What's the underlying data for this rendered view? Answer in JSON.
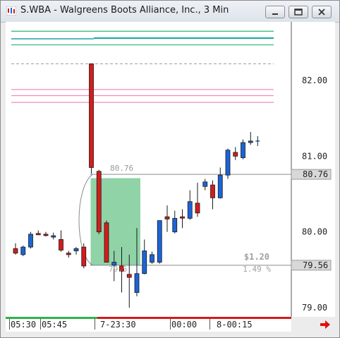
{
  "window": {
    "title": "S.WBA - Walgreens Boots Alliance, Inc., 3 Min",
    "app_icon": "chart-app-icon",
    "controls": [
      "minimize-icon",
      "restore-icon",
      "close-icon"
    ]
  },
  "price_axis": {
    "ticks": [
      "82.00",
      "81.00",
      "80.00",
      "79.00"
    ],
    "tags": {
      "upper": "80.76",
      "lower": "79.56"
    }
  },
  "annotation": {
    "level_label": "80.76",
    "change_amount": "$1.20",
    "change_percent": "1.49 %",
    "partial_label": "79.5"
  },
  "time_axis": {
    "labels": [
      "05:30",
      "05:45",
      "7-23:30",
      "00:00",
      "8-00:15"
    ]
  },
  "colors": {
    "up_candle": "#1a64d8",
    "down_candle": "#d41c1c",
    "highlight_box": "#7ccb98",
    "reference_lines_green": "#2bb673",
    "reference_lines_cyan": "#15a6a6",
    "reference_lines_pink": "#f08cc0",
    "reference_lines_gray": "#9a9a9a",
    "scroll_arrow": "#e01010"
  },
  "chart_data": {
    "type": "candlestick",
    "ylim": [
      78.85,
      83.0
    ],
    "y_ticks": [
      79.0,
      80.0,
      81.0,
      82.0
    ],
    "candles": [
      {
        "o": 79.78,
        "h": 79.85,
        "l": 79.7,
        "c": 79.72,
        "dir": "down"
      },
      {
        "o": 79.7,
        "h": 79.82,
        "l": 79.68,
        "c": 79.8,
        "dir": "up"
      },
      {
        "o": 79.8,
        "h": 80.0,
        "l": 79.78,
        "c": 79.97,
        "dir": "up"
      },
      {
        "o": 79.98,
        "h": 80.02,
        "l": 79.96,
        "c": 79.97,
        "dir": "down"
      },
      {
        "o": 79.97,
        "h": 80.0,
        "l": 79.94,
        "c": 79.96,
        "dir": "down"
      },
      {
        "o": 79.95,
        "h": 79.99,
        "l": 79.9,
        "c": 79.94,
        "dir": "up"
      },
      {
        "o": 79.9,
        "h": 80.02,
        "l": 79.74,
        "c": 79.76,
        "dir": "down"
      },
      {
        "o": 79.72,
        "h": 79.75,
        "l": 79.66,
        "c": 79.7,
        "dir": "down"
      },
      {
        "o": 79.75,
        "h": 79.8,
        "l": 79.7,
        "c": 79.78,
        "dir": "up"
      },
      {
        "o": 79.8,
        "h": 79.85,
        "l": 79.52,
        "c": 79.55,
        "dir": "down"
      },
      {
        "o": 82.22,
        "h": 82.22,
        "l": 80.77,
        "c": 80.85,
        "dir": "down"
      },
      {
        "o": 80.8,
        "h": 80.82,
        "l": 79.97,
        "c": 80.0,
        "dir": "down"
      },
      {
        "o": 80.12,
        "h": 80.15,
        "l": 79.6,
        "c": 79.6,
        "dir": "down"
      },
      {
        "o": 79.56,
        "h": 79.75,
        "l": 79.35,
        "c": 79.6,
        "dir": "up"
      },
      {
        "o": 79.55,
        "h": 79.8,
        "l": 79.2,
        "c": 79.48,
        "dir": "down"
      },
      {
        "o": 79.44,
        "h": 79.7,
        "l": 79.0,
        "c": 79.4,
        "dir": "down"
      },
      {
        "o": 79.2,
        "h": 80.05,
        "l": 79.15,
        "c": 79.45,
        "dir": "up"
      },
      {
        "o": 79.45,
        "h": 79.9,
        "l": 79.44,
        "c": 79.75,
        "dir": "up"
      },
      {
        "o": 79.6,
        "h": 79.74,
        "l": 79.58,
        "c": 79.7,
        "dir": "up"
      },
      {
        "o": 79.6,
        "h": 80.15,
        "l": 79.58,
        "c": 80.15,
        "dir": "up"
      },
      {
        "o": 80.2,
        "h": 80.35,
        "l": 80.0,
        "c": 80.17,
        "dir": "down"
      },
      {
        "o": 80.0,
        "h": 80.28,
        "l": 79.98,
        "c": 80.18,
        "dir": "up"
      },
      {
        "o": 80.2,
        "h": 80.3,
        "l": 80.05,
        "c": 80.2,
        "dir": "down"
      },
      {
        "o": 80.18,
        "h": 80.55,
        "l": 80.16,
        "c": 80.4,
        "dir": "up"
      },
      {
        "o": 80.38,
        "h": 80.65,
        "l": 80.2,
        "c": 80.25,
        "dir": "down"
      },
      {
        "o": 80.6,
        "h": 80.7,
        "l": 80.55,
        "c": 80.66,
        "dir": "up"
      },
      {
        "o": 80.62,
        "h": 80.68,
        "l": 80.3,
        "c": 80.45,
        "dir": "down"
      },
      {
        "o": 80.45,
        "h": 80.85,
        "l": 80.44,
        "c": 80.75,
        "dir": "up"
      },
      {
        "o": 80.75,
        "h": 81.1,
        "l": 80.7,
        "c": 81.08,
        "dir": "up"
      },
      {
        "o": 81.05,
        "h": 81.12,
        "l": 80.95,
        "c": 81.0,
        "dir": "down"
      },
      {
        "o": 80.98,
        "h": 81.22,
        "l": 80.96,
        "c": 81.18,
        "dir": "up"
      },
      {
        "o": 81.18,
        "h": 81.32,
        "l": 81.15,
        "c": 81.2,
        "dir": "up"
      }
    ],
    "reference_levels": [
      {
        "y": 82.65,
        "color": "green"
      },
      {
        "y": 82.55,
        "color": "cyan"
      },
      {
        "y": 82.47,
        "color": "green"
      },
      {
        "y": 82.22,
        "color": "gray"
      },
      {
        "y": 81.88,
        "color": "pink"
      },
      {
        "y": 81.8,
        "color": "pink"
      },
      {
        "y": 81.71,
        "color": "pink"
      }
    ],
    "price_lines": [
      80.76,
      79.56
    ],
    "highlight": {
      "from_candle": 10,
      "to_candle": 16,
      "top": 80.71,
      "bottom": 79.56
    }
  }
}
